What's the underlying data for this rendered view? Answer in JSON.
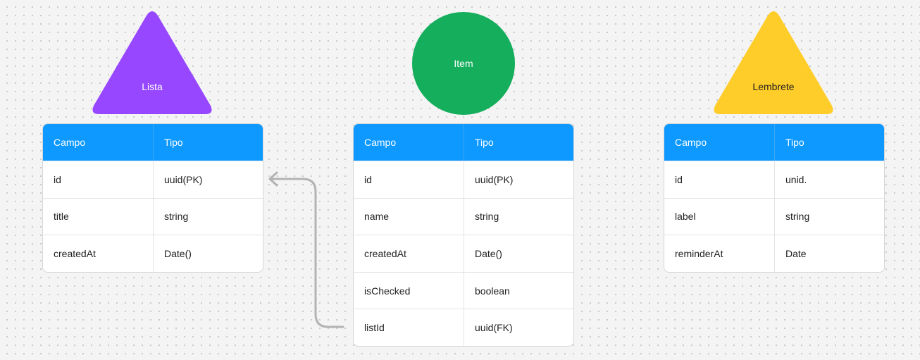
{
  "colors": {
    "lista_shape": "#9747ff",
    "item_shape": "#14ae5c",
    "lembrete_shape": "#ffcd29",
    "table_header": "#0d99ff",
    "connector": "#b3b3b3"
  },
  "entities": [
    {
      "shape": "triangle",
      "label": "Lista",
      "header": {
        "campo": "Campo",
        "tipo": "Tipo"
      },
      "rows": [
        {
          "campo": "id",
          "tipo": "uuid(PK)"
        },
        {
          "campo": "title",
          "tipo": "string"
        },
        {
          "campo": "createdAt",
          "tipo": "Date()"
        }
      ]
    },
    {
      "shape": "circle",
      "label": "Item",
      "header": {
        "campo": "Campo",
        "tipo": "Tipo"
      },
      "rows": [
        {
          "campo": "id",
          "tipo": "uuid(PK)"
        },
        {
          "campo": "name",
          "tipo": "string"
        },
        {
          "campo": "createdAt",
          "tipo": "Date()"
        },
        {
          "campo": "isChecked",
          "tipo": "boolean"
        },
        {
          "campo": "listId",
          "tipo": "uuid(FK)"
        }
      ]
    },
    {
      "shape": "triangle",
      "label": "Lembrete",
      "header": {
        "campo": "Campo",
        "tipo": "Tipo"
      },
      "rows": [
        {
          "campo": "id",
          "tipo": "unid."
        },
        {
          "campo": "label",
          "tipo": "string"
        },
        {
          "campo": "reminderAt",
          "tipo": "Date"
        }
      ]
    }
  ],
  "relations": [
    {
      "from": "Item.listId",
      "to": "Lista.id",
      "arrow": "arrow-left-icon"
    }
  ]
}
